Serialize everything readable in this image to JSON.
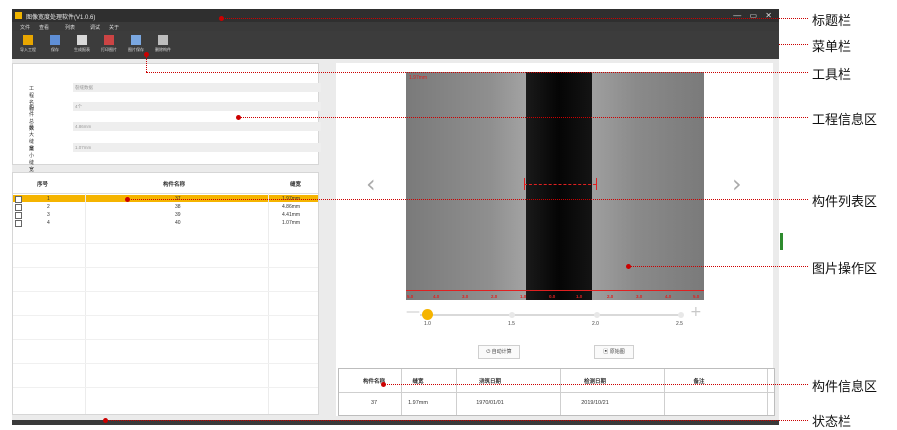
{
  "window": {
    "title": "图像宽度处理软件(V1.0.6)",
    "controls": "— ▭ ✕"
  },
  "menubar": {
    "items": [
      "文件",
      "查看",
      "列表",
      "调试",
      "关于"
    ]
  },
  "toolbar": {
    "items": [
      "导入工程",
      "保存",
      "生成报表",
      "打印图片",
      "图片保存",
      "删除构件"
    ]
  },
  "project_info": {
    "rows": [
      {
        "label": "工程名称",
        "value": "裂缝数据"
      },
      {
        "label": "构件总数",
        "value": "4个"
      },
      {
        "label": "最大缝宽",
        "value": "4.86mm"
      },
      {
        "label": "最小缝宽",
        "value": "1.07mm"
      }
    ]
  },
  "component_list": {
    "headers": {
      "index": "序号",
      "name": "构件名称",
      "width": "缝宽"
    },
    "rows": [
      {
        "index": "1",
        "name": "37",
        "width": "1.97mm",
        "selected": true
      },
      {
        "index": "2",
        "name": "38",
        "width": "4.86mm",
        "selected": false
      },
      {
        "index": "3",
        "name": "39",
        "width": "4.41mm",
        "selected": false
      },
      {
        "index": "4",
        "name": "40",
        "width": "1.07mm",
        "selected": false
      }
    ]
  },
  "image_view": {
    "width_label": "1.97mm",
    "ruler_ticks": [
      "5.0",
      "4.0",
      "3.0",
      "2.0",
      "1.0",
      "0.0",
      "1.0",
      "2.0",
      "3.0",
      "4.0",
      "5.0"
    ],
    "prev_glyph": "‹",
    "next_glyph": "›"
  },
  "zoom_slider": {
    "labels": [
      "1.0",
      "1.5",
      "2.0",
      "2.5"
    ],
    "value": 1.0,
    "minus": "—",
    "plus": "+"
  },
  "buttons": {
    "auto_calc": "自动计算",
    "original": "原始图"
  },
  "component_info": {
    "headers": [
      "构件名称",
      "缝宽",
      "浇筑日期",
      "检测日期",
      "备注"
    ],
    "row": [
      "37",
      "1.97mm",
      "1970/01/01",
      "2019/10/21",
      ""
    ]
  },
  "annotations": {
    "title_bar": "标题栏",
    "menu_bar": "菜单栏",
    "tool_bar": "工具栏",
    "project_area": "工程信息区",
    "list_area": "构件列表区",
    "image_area": "图片操作区",
    "info_area": "构件信息区",
    "status_bar": "状态栏"
  },
  "colors": {
    "highlight": "#f5b400",
    "measure": "#e02020",
    "callout": "#cc0000",
    "chrome": "#3a3a3a"
  }
}
